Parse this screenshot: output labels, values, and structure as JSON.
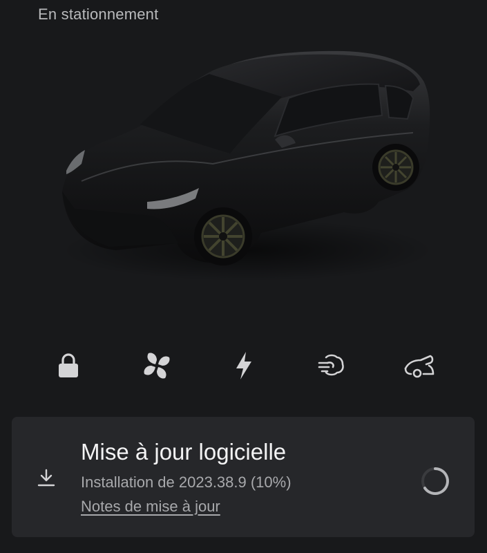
{
  "status": {
    "label": "En stationnement"
  },
  "quick_actions": [
    {
      "icon": "lock-icon"
    },
    {
      "icon": "fan-icon"
    },
    {
      "icon": "charge-bolt-icon"
    },
    {
      "icon": "frunk-icon"
    },
    {
      "icon": "trunk-icon"
    }
  ],
  "update_card": {
    "title": "Mise à jour logicielle",
    "subtitle": "Installation de 2023.38.9 (10%)",
    "link": "Notes de mise à jour",
    "progress": 0.1
  },
  "colors": {
    "background": "#18191b",
    "card": "#26272a",
    "icon": "#d4d4d6"
  }
}
